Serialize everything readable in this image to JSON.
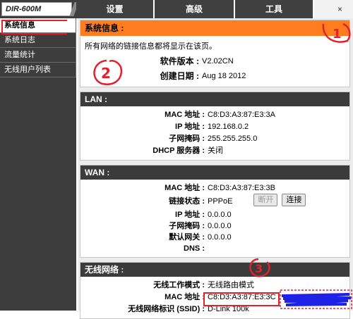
{
  "header": {
    "model": "DIR-600M",
    "tabs": [
      {
        "label": "设置"
      },
      {
        "label": "高级"
      },
      {
        "label": "工具"
      },
      {
        "label": ""
      }
    ],
    "close_glyph": "×"
  },
  "sidebar": {
    "items": [
      {
        "label": "系统信息"
      },
      {
        "label": "系统日志"
      },
      {
        "label": "流量统计"
      },
      {
        "label": "无线用户列表"
      }
    ]
  },
  "system_info": {
    "title": "系统信息 :",
    "intro": "所有网络的链接信息都将显示在该页。",
    "firmware_label": "软件版本 :",
    "firmware_value": "V2.02CN",
    "date_label": "创建日期 :",
    "date_value": "Aug 18 2012"
  },
  "lan": {
    "title": "LAN :",
    "rows": [
      {
        "label": "MAC 地址 :",
        "value": "C8:D3:A3:87:E3:3A"
      },
      {
        "label": "IP 地址 :",
        "value": "192.168.0.2"
      },
      {
        "label": "子网掩码 :",
        "value": "255.255.255.0"
      },
      {
        "label": "DHCP 服务器 :",
        "value": "关闭"
      }
    ]
  },
  "wan": {
    "title": "WAN :",
    "mac_label": "MAC 地址 :",
    "mac_value": "C8:D3:A3:87:E3:3B",
    "status_label": "链接状态 :",
    "status_value": "PPPoE",
    "disconnect_label": "断开",
    "connect_label": "连接",
    "rows": [
      {
        "label": "IP 地址 :",
        "value": "0.0.0.0"
      },
      {
        "label": "子网掩码 :",
        "value": "0.0.0.0"
      },
      {
        "label": "默认网关 :",
        "value": "0.0.0.0"
      },
      {
        "label": "DNS :",
        "value": ""
      }
    ]
  },
  "wireless": {
    "title": "无线网络 :",
    "mode_label": "无线工作模式 :",
    "mode_value": "无线路由模式",
    "mac_label": "MAC 地址 :",
    "mac_value": "C8:D3:A3:87:E3:3C",
    "ssid_label": "无线网络标识 (SSID) :",
    "ssid_value": "D-Link 100k"
  },
  "annotations": {
    "marker_1": "1",
    "marker_2": "2",
    "marker_3": "3",
    "color": "#e2212b",
    "redaction_color": "#1e22e6"
  }
}
